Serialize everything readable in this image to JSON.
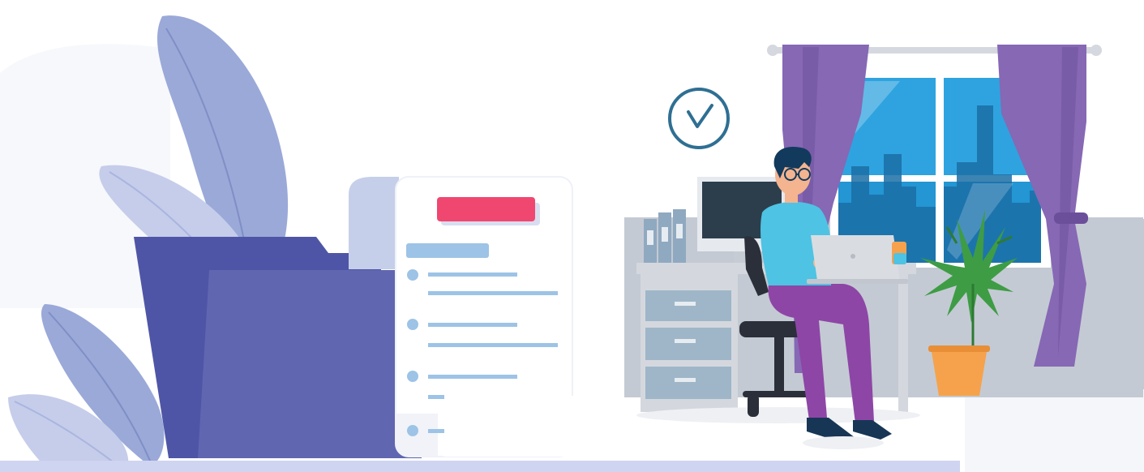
{
  "illustration": {
    "subject": "office-work-illustration",
    "colors": {
      "background": "#ffffff",
      "leaf_primary": "#9aa9d8",
      "leaf_secondary": "#c5cdea",
      "folder_back": "#4f55a6",
      "folder_front": "#6066b0",
      "paper": "#ffffff",
      "paper_curl": "#c6cfe9",
      "paper_header": "#ef4770",
      "paper_line": "#9dc3e6",
      "floor_bar": "#cfd4f0",
      "wall_panel": "#c4cad3",
      "desk_top": "#d4d8de",
      "drawer": "#9fb6c8",
      "curtain": "#8668b5",
      "window_sky": "#2fa3df",
      "window_frame": "#ffffff",
      "person_shirt": "#4ec3e3",
      "person_pants": "#8d46a6",
      "person_hair": "#123a5c",
      "skin": "#f3b48f",
      "laptop": "#d9dde2",
      "pot": "#f6a24c",
      "plant": "#3e9c45",
      "clock_ring": "#2f6f93"
    },
    "icons": [
      "leaf-icon",
      "folder-icon",
      "document-icon",
      "clock-icon",
      "window-icon",
      "curtain-icon",
      "monitor-icon",
      "desk-icon",
      "office-chair-icon",
      "laptop-icon",
      "potted-plant-icon",
      "binder-icon",
      "person-icon"
    ]
  }
}
